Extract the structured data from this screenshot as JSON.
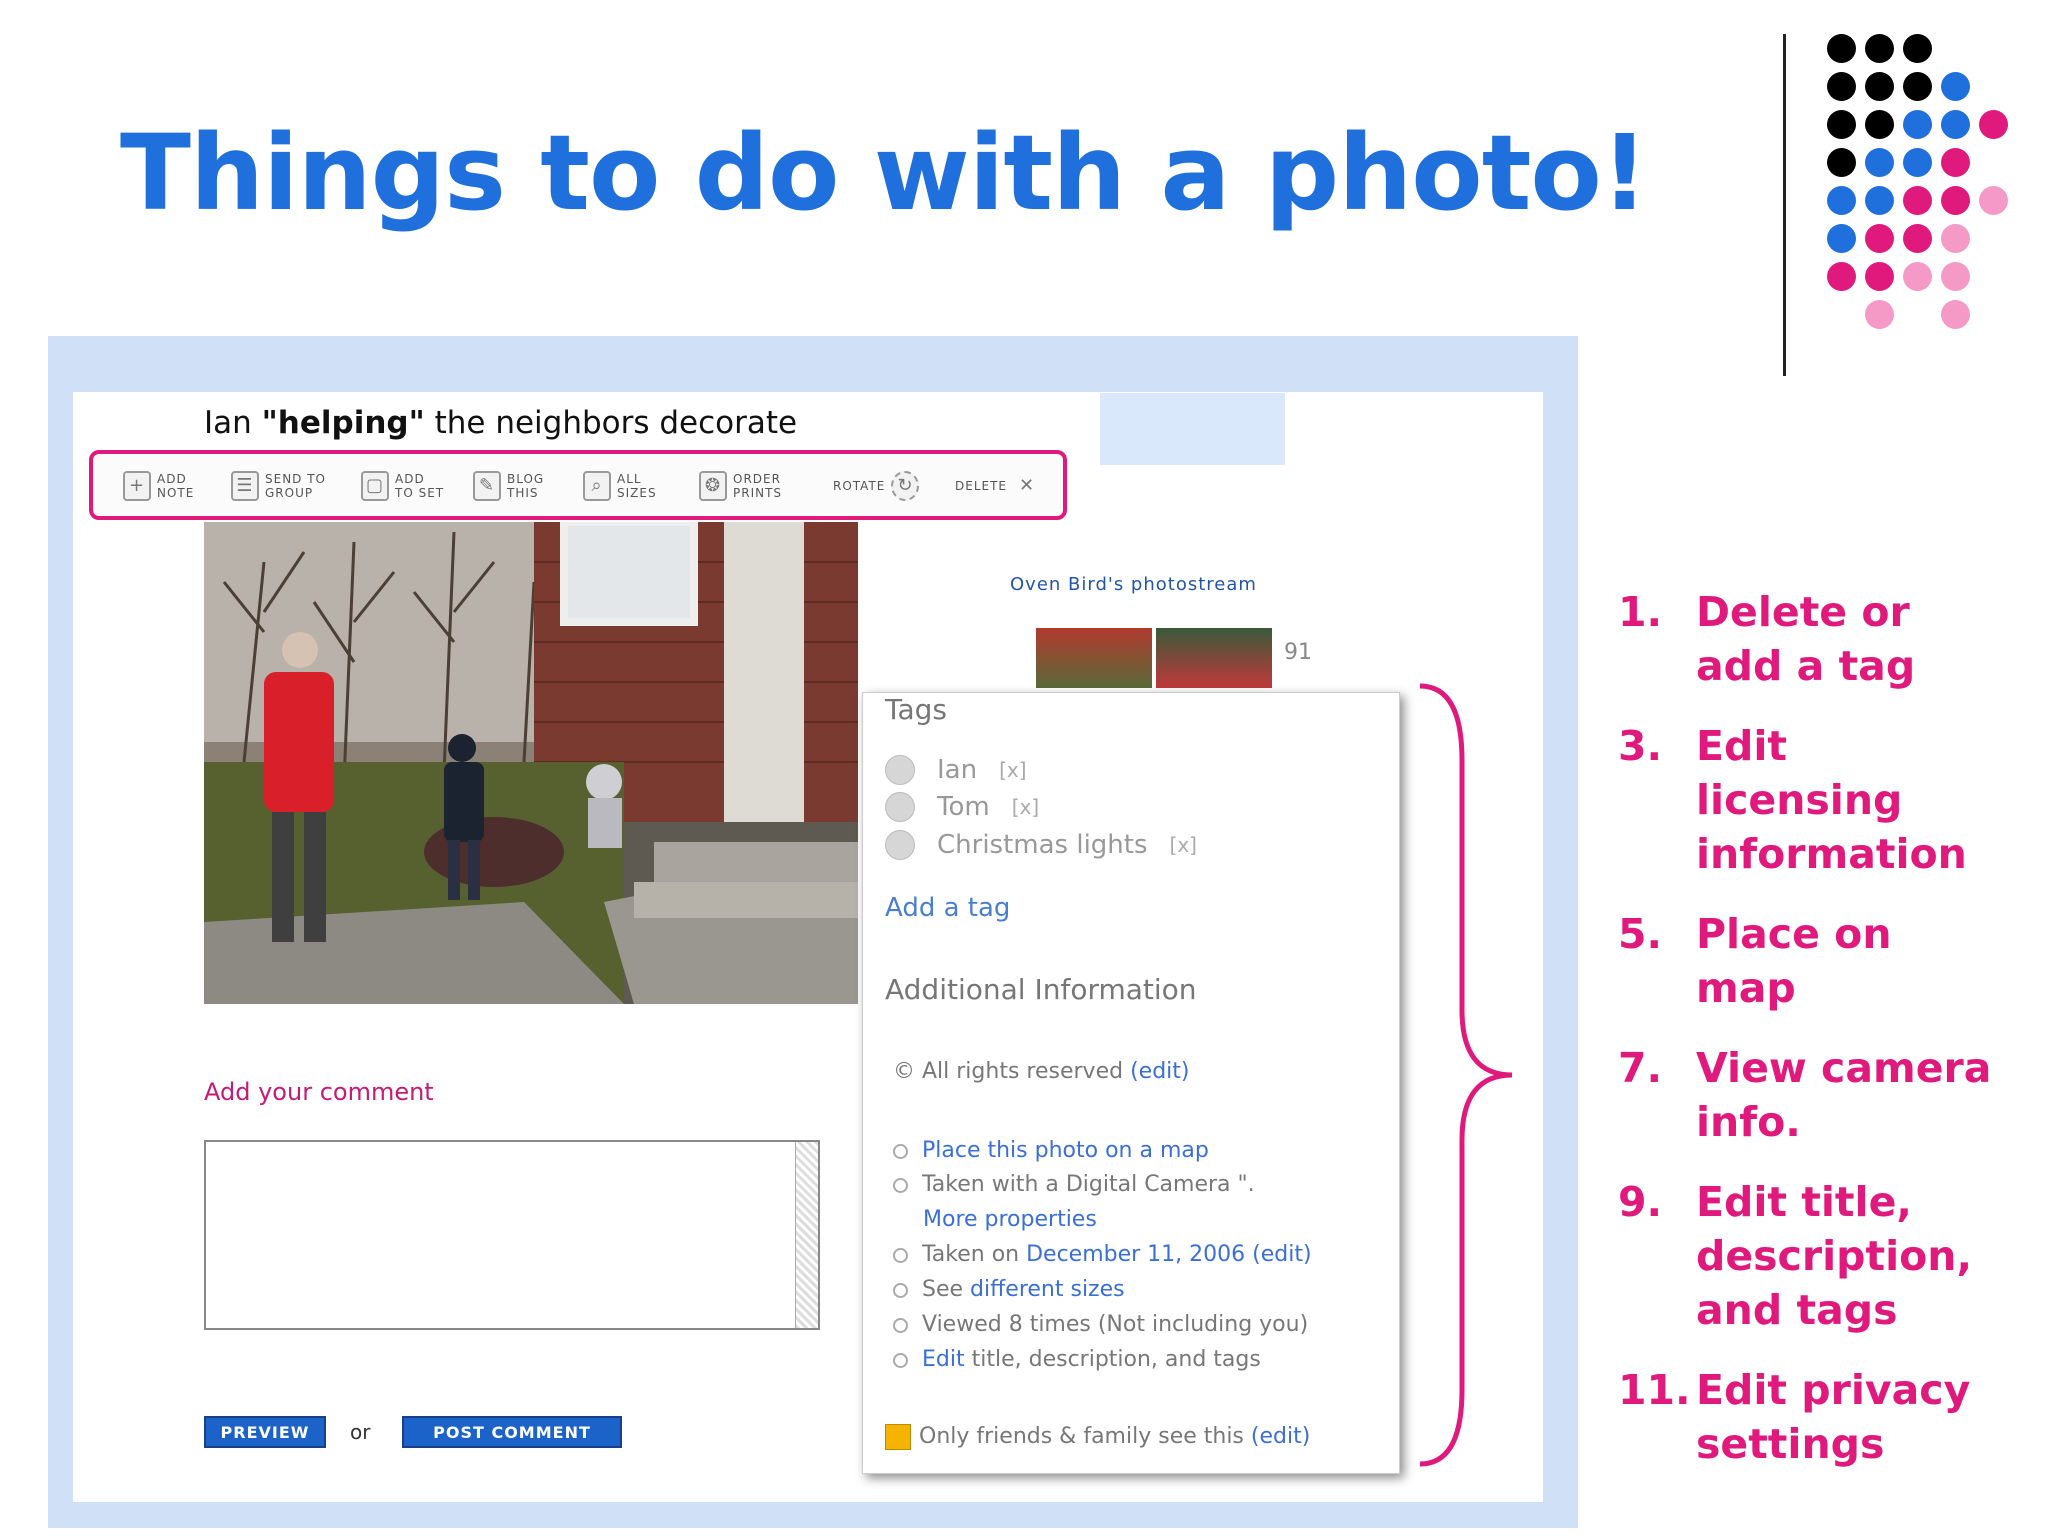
{
  "slide": {
    "title": "Things to do with a photo!"
  },
  "screenshot": {
    "photo_title_prefix": "Ian ",
    "photo_title_bold": "\"helping\"",
    "photo_title_suffix": " the neighbors decorate",
    "toolbar": [
      {
        "line1": "ADD",
        "line2": "NOTE",
        "icon": "+"
      },
      {
        "line1": "SEND TO",
        "line2": "GROUP",
        "icon": "☰"
      },
      {
        "line1": "ADD",
        "line2": "TO SET",
        "icon": "▢"
      },
      {
        "line1": "BLOG",
        "line2": "THIS",
        "icon": "✎"
      },
      {
        "line1": "ALL",
        "line2": "SIZES",
        "icon": "⌕"
      },
      {
        "line1": "ORDER",
        "line2": "PRINTS",
        "icon": "❂"
      },
      {
        "line1": "ROTATE",
        "line2": "",
        "icon": "↻"
      },
      {
        "line1": "DELETE",
        "line2": "",
        "icon": "✕"
      }
    ],
    "photostream": "Oven Bird's photostream",
    "thumb_count": "91",
    "tags_header": "Tags",
    "tags": [
      {
        "label": "Ian",
        "remove": "[x]"
      },
      {
        "label": "Tom",
        "remove": "[x]"
      },
      {
        "label": "Christmas lights",
        "remove": "[x]"
      }
    ],
    "add_tag": "Add a tag",
    "additional_info_header": "Additional Information",
    "rights_text": "© All rights reserved",
    "rights_edit": "(edit)",
    "place_map": "Place this photo on a map",
    "camera_text": "Taken with a Digital Camera \".",
    "more_properties": "More properties",
    "taken_on_prefix": "Taken on",
    "taken_on_date": "December 11, 2006",
    "taken_on_edit": "(edit)",
    "see_prefix": "See",
    "see_link": "different sizes",
    "viewed": "Viewed 8 times (Not including you)",
    "edit_link": "Edit",
    "edit_rest": "title, description, and tags",
    "privacy_text": "Only friends & family see this",
    "privacy_edit": "(edit)",
    "add_comment": "Add your comment",
    "preview_button": "PREVIEW",
    "or_text": "or",
    "post_button": "POST COMMENT"
  },
  "steps": [
    {
      "num": "1.",
      "text": "Delete or add a tag"
    },
    {
      "num": "3.",
      "text": "Edit licensing information"
    },
    {
      "num": "5.",
      "text": "Place on map"
    },
    {
      "num": "7.",
      "text": "View camera info."
    },
    {
      "num": "9.",
      "text": "Edit title, description, and tags"
    },
    {
      "num": "11.",
      "text": "Edit privacy settings"
    }
  ],
  "colors": {
    "title_blue": "#1f6fdc",
    "accent_pink": "#e0197d",
    "frame_blue": "#cfe0f7",
    "link_blue": "#3b6fd8"
  }
}
